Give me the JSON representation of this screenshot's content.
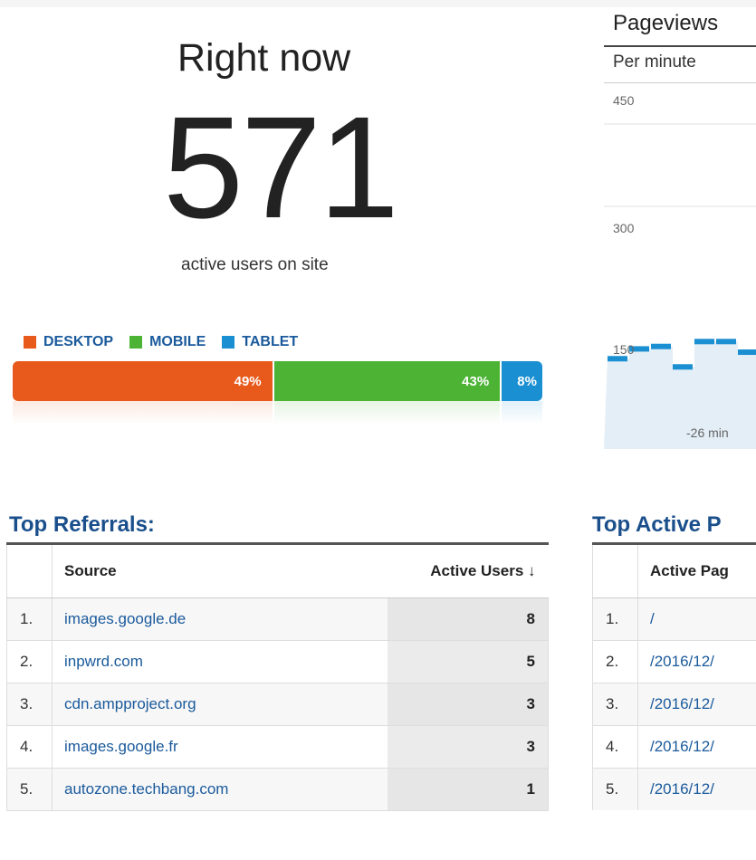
{
  "realtime": {
    "title": "Right now",
    "active_count": "571",
    "subtitle": "active users on site"
  },
  "devices": {
    "legend": [
      {
        "label": "DESKTOP",
        "color": "#e8591c"
      },
      {
        "label": "MOBILE",
        "color": "#4cb335"
      },
      {
        "label": "TABLET",
        "color": "#1a8fd1"
      }
    ],
    "segments": [
      {
        "label": "49%",
        "share": 0.49,
        "color": "#e8591c"
      },
      {
        "label": "43%",
        "share": 0.43,
        "color": "#4cb335"
      },
      {
        "label": "8%",
        "share": 0.08,
        "color": "#1a8fd1"
      }
    ]
  },
  "pageviews": {
    "title": "Pageviews",
    "subtitle": "Per minute",
    "y_ticks": [
      "450",
      "300",
      "150"
    ],
    "x_label": "-26 min"
  },
  "chart_data": {
    "type": "bar",
    "title": "Pageviews",
    "subtitle": "Per minute",
    "ylim": [
      0,
      450
    ],
    "y_ticks": [
      450,
      300,
      150
    ],
    "x_ticks": [
      "-26 min"
    ],
    "values": [
      163,
      175,
      178,
      153,
      184,
      184,
      171
    ],
    "color": "#1a8fd1"
  },
  "top_referrals": {
    "title": "Top Referrals:",
    "columns": [
      "Source",
      "Active Users ↓"
    ],
    "rows": [
      {
        "rank": "1.",
        "source": "images.google.de",
        "users": "8"
      },
      {
        "rank": "2.",
        "source": "inpwrd.com",
        "users": "5"
      },
      {
        "rank": "3.",
        "source": "cdn.ampproject.org",
        "users": "3"
      },
      {
        "rank": "4.",
        "source": "images.google.fr",
        "users": "3"
      },
      {
        "rank": "5.",
        "source": "autozone.techbang.com",
        "users": "1"
      }
    ]
  },
  "top_pages": {
    "title": "Top Active P",
    "columns": [
      "Active Pag"
    ],
    "rows": [
      {
        "rank": "1.",
        "page": "/"
      },
      {
        "rank": "2.",
        "page": "/2016/12/"
      },
      {
        "rank": "3.",
        "page": "/2016/12/"
      },
      {
        "rank": "4.",
        "page": "/2016/12/"
      },
      {
        "rank": "5.",
        "page": "/2016/12/"
      }
    ]
  }
}
